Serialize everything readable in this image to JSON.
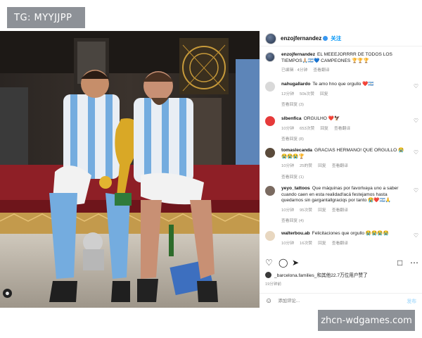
{
  "tg_badge": "TG: MYYJJPP",
  "watermark": "zhcn-wdgames.com",
  "post": {
    "author": "enzojfernandez",
    "follow_label": "关注",
    "caption_user": "enzojfernandez",
    "caption_text": "EL MEEEJORRRR DE TODOS LOS TIEMPOS🙏🏼🇦🇷💙 CAMPEONES 🏆🏆🏆",
    "caption_time": "已编辑 · 4分钟",
    "caption_translate": "查看翻译"
  },
  "comments": [
    {
      "user": "nahugallardo",
      "text": "Te amo hno que orgullo ❤️🇦🇷",
      "time": "12分钟",
      "likes": "50k次赞",
      "reply": "回复",
      "replies": "查看回复 (3)"
    },
    {
      "user": "slbenfica",
      "text": "ORGULHO ❤️🦅",
      "time": "10分钟",
      "likes": "653次赞",
      "reply": "回复",
      "translate": "查看翻译",
      "replies": "查看回复 (8)"
    },
    {
      "user": "tomaslecanda",
      "text": "GRACIAS HERMANO! QUE ORGULLO 😭😭😭😭🏆",
      "time": "10分钟",
      "likes": "25的赞",
      "reply": "回复",
      "translate": "查看翻译",
      "replies": "查看回复 (1)"
    },
    {
      "user": "yeyo_tattoos",
      "text": "Que máquinas por favorlvaya uno a saber cuando caen en esta realidad!acá festejamos hasta quedarnos sin gargantallgraciqs por tanto 😭❤️🇦🇷🙏",
      "time": "10分钟",
      "likes": "95次赞",
      "reply": "回复",
      "translate": "查看翻译",
      "replies": "查看回复 (4)"
    },
    {
      "user": "walterbou.ab",
      "text": "Felicitaciones que orgullo 😭😭😭😭",
      "time": "10分钟",
      "likes": "16次赞",
      "reply": "回复",
      "translate": "查看翻译"
    }
  ],
  "liked_by": "_barcelona.families_和其他22.7万位用户赞了",
  "post_age": "19分钟前",
  "comment_placeholder": "添加评论...",
  "send_label": "发布",
  "icons": [
    "more-icon",
    "heart-icon",
    "comment-icon",
    "share-icon",
    "bookmark-icon",
    "smile-icon",
    "user-tag-icon"
  ]
}
